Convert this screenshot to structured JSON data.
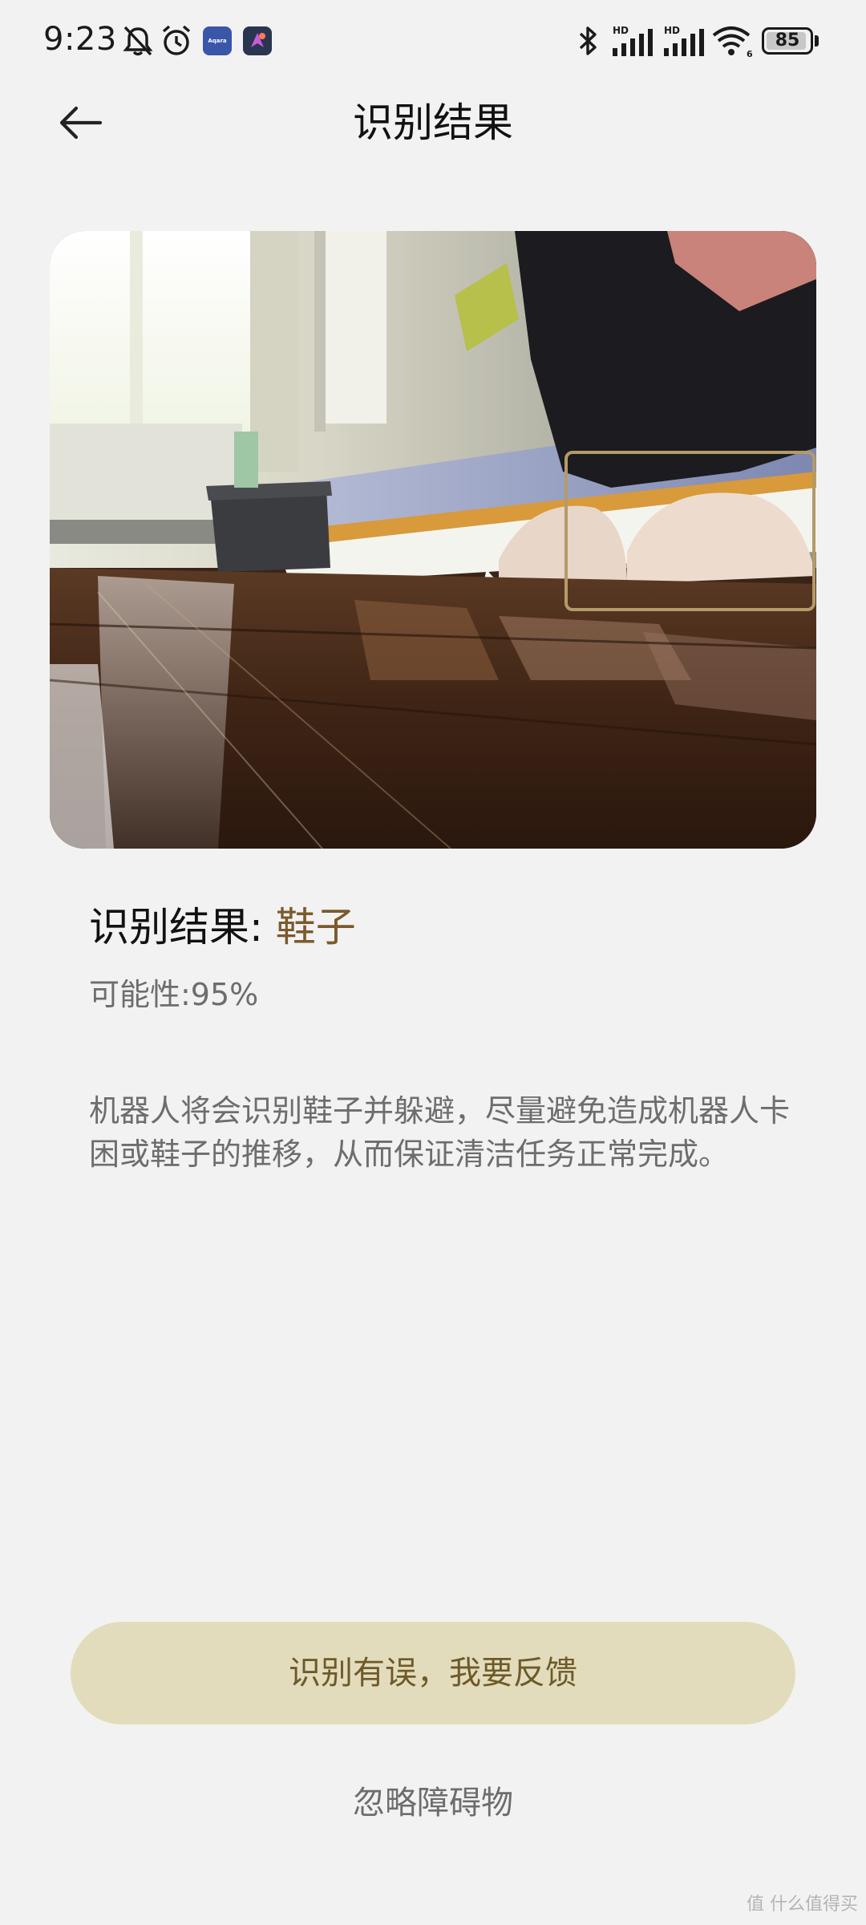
{
  "status_bar": {
    "time": "9:23",
    "aqara_label": "Aqara",
    "battery_level": "85",
    "icons": [
      "mute-icon",
      "alarm-icon",
      "aqara-app-icon",
      "navigation-app-icon",
      "bluetooth-icon",
      "signal-hd-1-icon",
      "signal-hd-2-icon",
      "wifi-6-icon",
      "battery-icon"
    ],
    "hd_label": "HD",
    "wifi_label": "6"
  },
  "header": {
    "title": "识别结果",
    "back_icon": "arrow-left-icon"
  },
  "photo": {
    "description_icon": "detection-box",
    "detection_confidence": 0.95
  },
  "result": {
    "label": "识别结果: ",
    "value": "鞋子",
    "probability": "可能性:95%",
    "description": "机器人将会识别鞋子并躲避，尽量避免造成机器人卡困或鞋子的推移，从而保证清洁任务正常完成。"
  },
  "actions": {
    "feedback": "识别有误，我要反馈",
    "ignore": "忽略障碍物"
  },
  "watermark": "值 什么值得买",
  "colors": {
    "background": "#f2f2f2",
    "accent_text": "#7b5a2c",
    "button_bg": "#e3dcbc",
    "detect_box": "#b49a68"
  }
}
